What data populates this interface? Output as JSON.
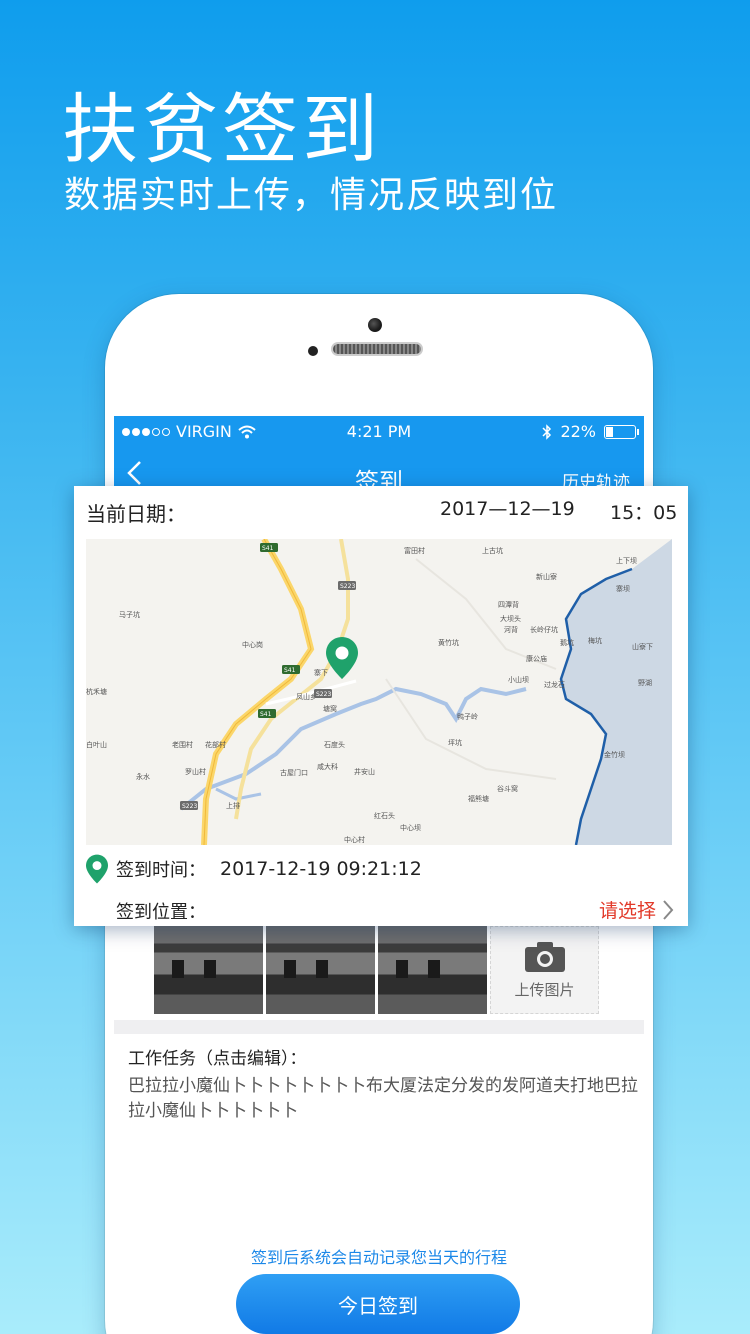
{
  "hero": {
    "title": "扶贫签到",
    "subtitle": "数据实时上传，情况反映到位"
  },
  "status_bar": {
    "carrier": "VIRGIN",
    "time": "4:21 PM",
    "battery": "22%",
    "battery_level": 0.22
  },
  "nav": {
    "title": "签到",
    "right": "历史轨迹"
  },
  "card": {
    "date_label": "当前日期：",
    "date_value": "2017—12—19",
    "time_value": "15：05",
    "checkin_time_label": "签到时间：",
    "checkin_time_value": "2017-12-19 09:21:12",
    "location_label": "签到位置：",
    "location_select": "请选择"
  },
  "map": {
    "places": [
      "富田村",
      "上古坑",
      "新山寮",
      "上下坝",
      "寨坝",
      "马子坑",
      "四潭背",
      "大坝头",
      "河背",
      "长岭仔坑",
      "黄竹坑",
      "鹅坑",
      "梅坑",
      "山寮下",
      "中心岗",
      "寨下",
      "凤山乡",
      "塘窝",
      "康公庙",
      "过龙石",
      "野湖",
      "小山坝",
      "杭禾塘",
      "鸭子岭",
      "坪坑",
      "白叶山",
      "老围村",
      "花部村",
      "石度头",
      "金竹坝",
      "永水",
      "罗山村",
      "咸大科",
      "古屋门口",
      "井安山",
      "谷斗窝",
      "福熊塘",
      "红石头",
      "中心村",
      "中心坝",
      "上排"
    ],
    "roads": [
      "S41",
      "S223",
      "S223",
      "S41",
      "S41",
      "S223"
    ]
  },
  "photos_upload_label": "上传图片",
  "task": {
    "label": "工作任务（点击编辑）：",
    "text": "巴拉拉小魔仙卜卜卜卜卜卜卜卜布大厦法定分发的发阿道夫打地巴拉拉小魔仙卜卜卜卜卜卜"
  },
  "footer": {
    "hint": "签到后系统会自动记录您当天的行程",
    "button": "今日签到"
  },
  "colors": {
    "accent": "#1798ef",
    "select_red": "#e23a2a",
    "pin_green": "#1fa26b"
  }
}
